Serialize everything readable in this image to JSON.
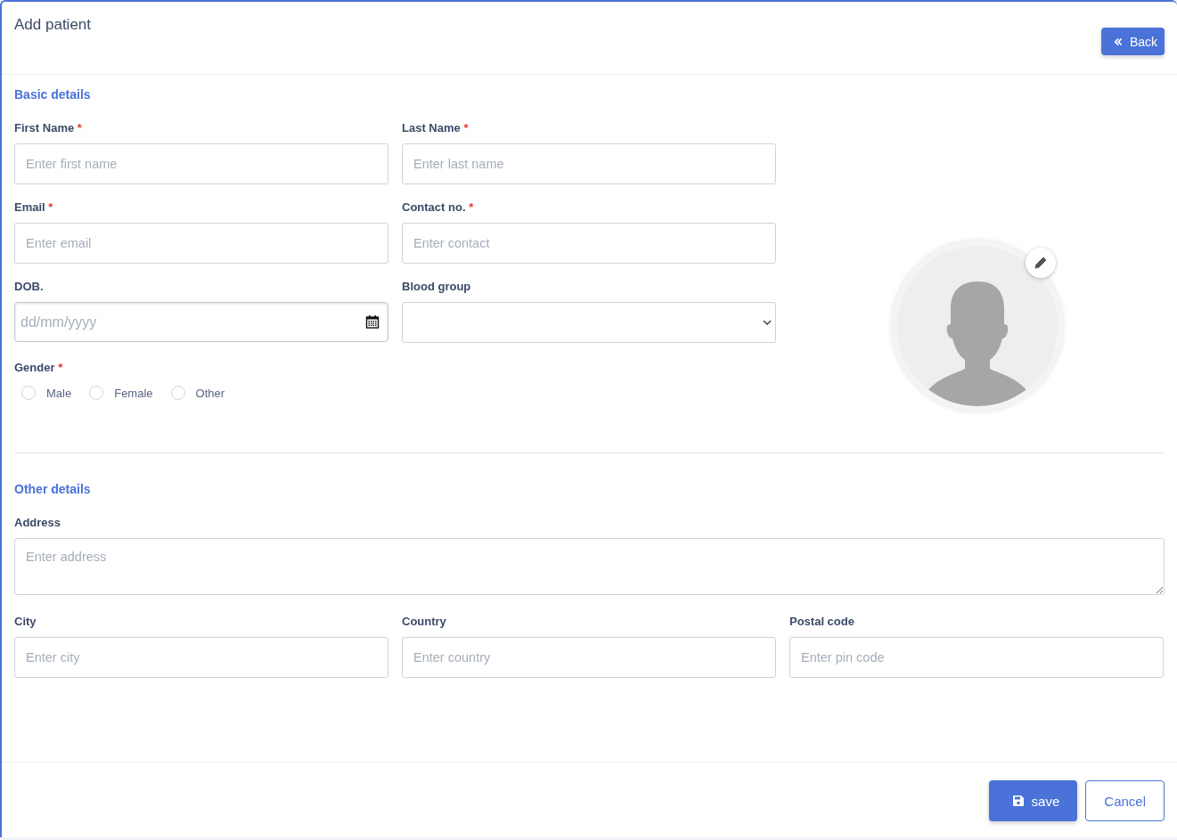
{
  "header": {
    "title": "Add patient",
    "back_button": "Back"
  },
  "basic_details": {
    "heading": "Basic details",
    "fields": [
      {
        "kind": "text",
        "label": "First Name",
        "required_mark": "*",
        "placeholder": "Enter first name"
      },
      {
        "kind": "text",
        "label": "Last Name",
        "required_mark": "*",
        "placeholder": "Enter last name"
      },
      {
        "kind": "text",
        "label": "Email",
        "required_mark": "*",
        "placeholder": "Enter email"
      },
      {
        "kind": "text",
        "label": "Contact no.",
        "required_mark": "*",
        "placeholder": "Enter contact"
      },
      {
        "kind": "date",
        "label": "DOB.",
        "placeholder": "dd/mm/yyyy"
      },
      {
        "kind": "select",
        "label": "Blood group"
      }
    ],
    "gender": {
      "label": "Gender",
      "required_mark": "*",
      "options": [
        {
          "label": "Male",
          "selected": false
        },
        {
          "label": "Female",
          "selected": false
        },
        {
          "label": "Other",
          "selected": false
        }
      ]
    }
  },
  "other_details": {
    "heading": "Other details",
    "address": {
      "label": "Address",
      "placeholder": "Enter address"
    },
    "fields": [
      {
        "kind": "text",
        "label": "City",
        "placeholder": "Enter city"
      },
      {
        "kind": "text",
        "label": "Country",
        "placeholder": "Enter country"
      },
      {
        "kind": "text",
        "label": "Postal code",
        "placeholder": "Enter pin code"
      }
    ]
  },
  "footer": {
    "save_button": "save",
    "cancel_button": "Cancel"
  }
}
